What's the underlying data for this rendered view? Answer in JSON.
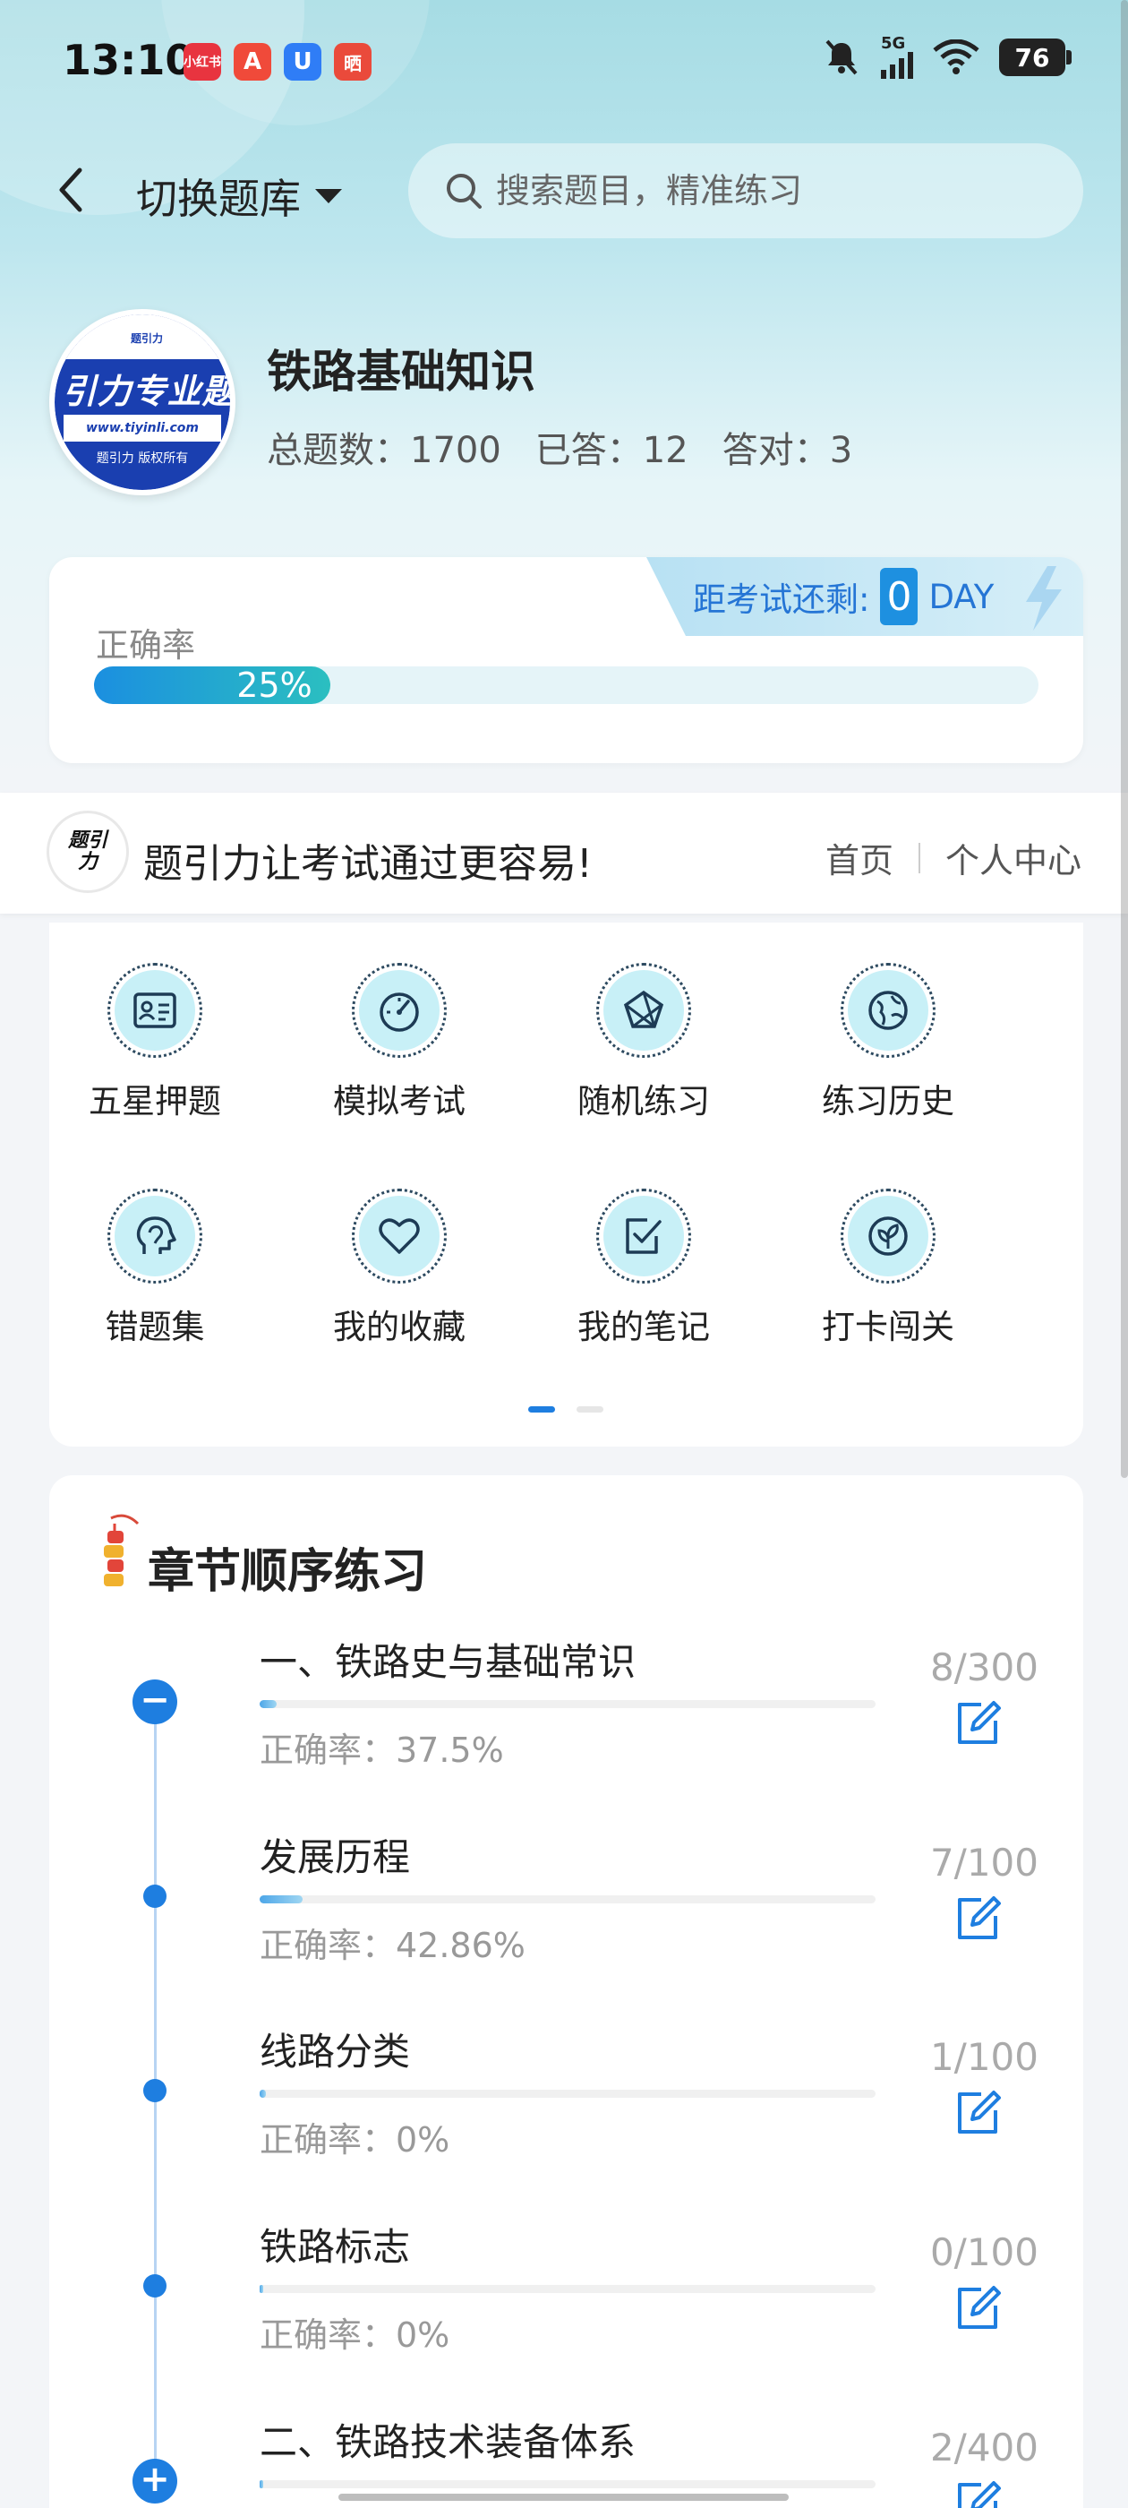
{
  "status": {
    "time": "13:10",
    "apps": [
      "小红书",
      "A",
      "U",
      "晒"
    ],
    "network": "5G",
    "battery": "76"
  },
  "header": {
    "switch_label": "切换题库",
    "search_placeholder": "搜索题目，精准练习"
  },
  "bank": {
    "logo_top": "题引力",
    "logo_main": "引力专业题",
    "logo_url": "www.tiyinli.com",
    "logo_copy": "题引力 版权所有",
    "title": "铁路基础知识",
    "total": "总题数：1700",
    "answered": "已答：12",
    "correct": "答对：3"
  },
  "countdown": {
    "label": "距考试还剩:",
    "days": "0",
    "unit": "DAY"
  },
  "accuracy": {
    "label": "正确率",
    "value_text": "25%",
    "fraction": 0.25
  },
  "slogan": {
    "logo_text": "题引力",
    "text": "题引力让考试通过更容易!",
    "home": "首页",
    "personal": "个人中心"
  },
  "features": [
    {
      "label": "五星押题",
      "icon": "id-card-icon"
    },
    {
      "label": "模拟考试",
      "icon": "speedometer-icon"
    },
    {
      "label": "随机练习",
      "icon": "network-icon"
    },
    {
      "label": "练习历史",
      "icon": "globe-icon"
    },
    {
      "label": "错题集",
      "icon": "head-icon"
    },
    {
      "label": "我的收藏",
      "icon": "heart-icon"
    },
    {
      "label": "我的笔记",
      "icon": "note-check-icon"
    },
    {
      "label": "打卡闯关",
      "icon": "leaf-icon"
    }
  ],
  "chapters": {
    "title": "章节顺序练习",
    "rows": [
      {
        "title": "一、铁路史与基础常识",
        "acc": "正确率：37.5%",
        "count": "8/300",
        "progress": 0.027,
        "node": "minus"
      },
      {
        "title": "发展历程",
        "acc": "正确率：42.86%",
        "count": "7/100",
        "progress": 0.07,
        "node": "dot"
      },
      {
        "title": "线路分类",
        "acc": "正确率：0%",
        "count": "1/100",
        "progress": 0.01,
        "node": "dot"
      },
      {
        "title": "铁路标志",
        "acc": "正确率：0%",
        "count": "0/100",
        "progress": 0.0,
        "node": "dot"
      },
      {
        "title": "二、铁路技术装备体系",
        "acc": "",
        "count": "2/400",
        "progress": 0.005,
        "node": "plus"
      }
    ]
  },
  "colors": {
    "accent": "#1e7ee0",
    "teal": "#2bbfc0",
    "icon_bg": "#c8f0f7"
  }
}
